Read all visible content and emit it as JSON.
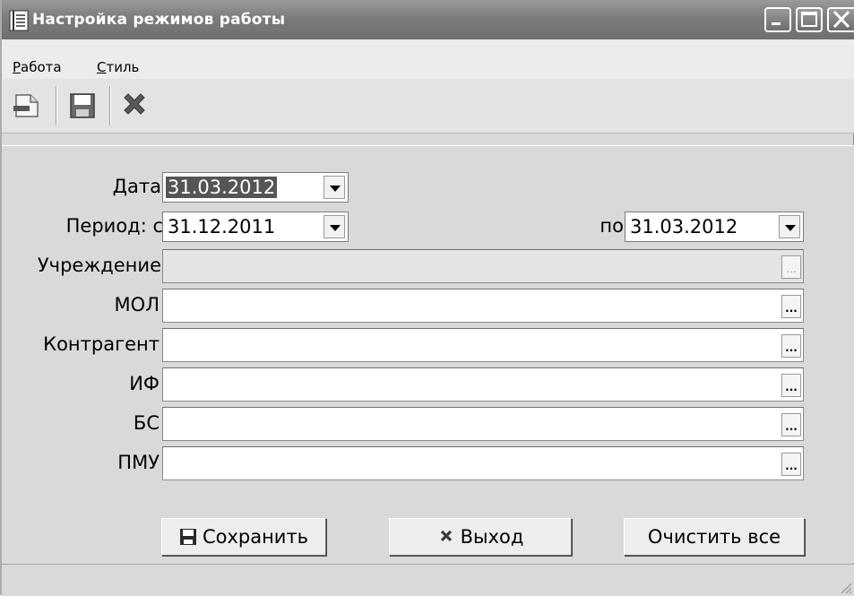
{
  "window": {
    "title": "Настройка режимов работы"
  },
  "menu": {
    "items": [
      {
        "underline": "Р",
        "rest": "абота"
      },
      {
        "underline": "С",
        "rest": "тиль"
      }
    ]
  },
  "toolbar": {
    "icons": [
      "new-document-icon",
      "save-icon",
      "delete-icon"
    ]
  },
  "form": {
    "date_label": "Дата",
    "date_value": "31.03.2012",
    "period_label": "Период: с",
    "period_from": "31.12.2011",
    "period_to_label": "по",
    "period_to": "31.03.2012",
    "fields": [
      {
        "label": "Учреждение",
        "value": "",
        "enabled": false
      },
      {
        "label": "МОЛ",
        "value": "",
        "enabled": true
      },
      {
        "label": "Контрагент",
        "value": "",
        "enabled": true
      },
      {
        "label": "ИФ",
        "value": "",
        "enabled": true
      },
      {
        "label": "БС",
        "value": "",
        "enabled": true
      },
      {
        "label": "ПМУ",
        "value": "",
        "enabled": true
      }
    ],
    "lookup_button": "..."
  },
  "buttons": {
    "save": "Сохранить",
    "exit": "Выход",
    "clear": "Очистить все"
  },
  "colors": {
    "titlebar": "#7c7c7c",
    "panel": "#d9d9d9",
    "selection": "#555555"
  }
}
